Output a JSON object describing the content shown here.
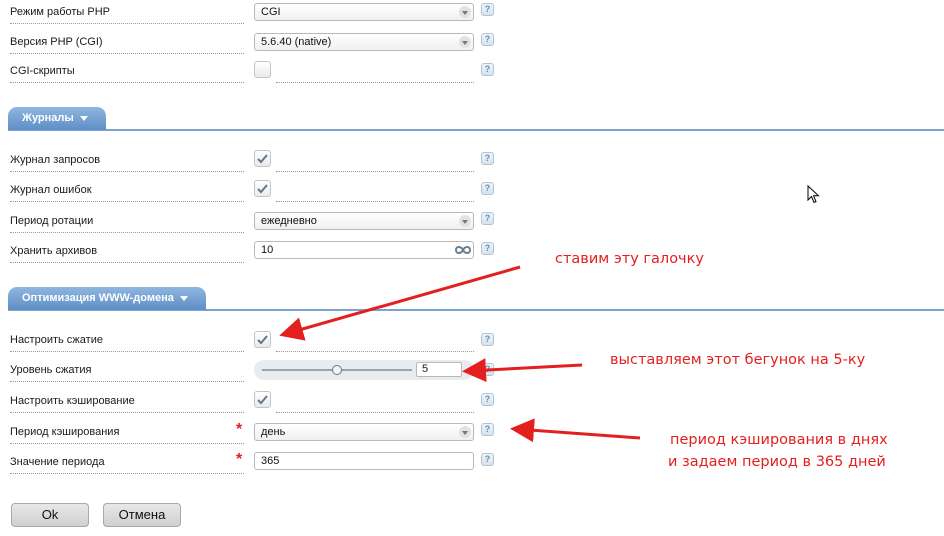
{
  "php": {
    "mode": {
      "label": "Режим работы PHP",
      "value": "CGI"
    },
    "version": {
      "label": "Версия PHP (CGI)",
      "value": "5.6.40 (native)"
    },
    "cgi": {
      "label": "CGI-скрипты",
      "checked": false
    }
  },
  "logs": {
    "section_title": "Журналы",
    "request_log": {
      "label": "Журнал запросов",
      "checked": true
    },
    "error_log": {
      "label": "Журнал ошибок",
      "checked": true
    },
    "rotation": {
      "label": "Период ротации",
      "value": "ежедневно"
    },
    "archives": {
      "label": "Хранить архивов",
      "value": "10",
      "icon": "infinity-icon"
    }
  },
  "optimization": {
    "section_title": "Оптимизация WWW-домена",
    "compression": {
      "label": "Настроить сжатие",
      "checked": true
    },
    "level": {
      "label": "Уровень сжатия",
      "value": "5",
      "slider_fraction": 0.5
    },
    "caching": {
      "label": "Настроить кэширование",
      "checked": true
    },
    "cache_period": {
      "label": "Период кэширования",
      "value": "день",
      "required": "*"
    },
    "period_value": {
      "label": "Значение периода",
      "value": "365",
      "required": "*"
    }
  },
  "help_glyph": "?",
  "buttons": {
    "ok": "Ok",
    "cancel": "Отмена"
  },
  "annotations": {
    "note1": "ставим эту галочку",
    "note2": "выставляем этот бегунок на 5-ку",
    "note3_line1": "период кэширования в днях",
    "note3_line2": "и задаем период в 365 дней"
  },
  "colors": {
    "accent": "#5f8fc6",
    "annotation": "#e3201f",
    "required": "#e02020"
  }
}
